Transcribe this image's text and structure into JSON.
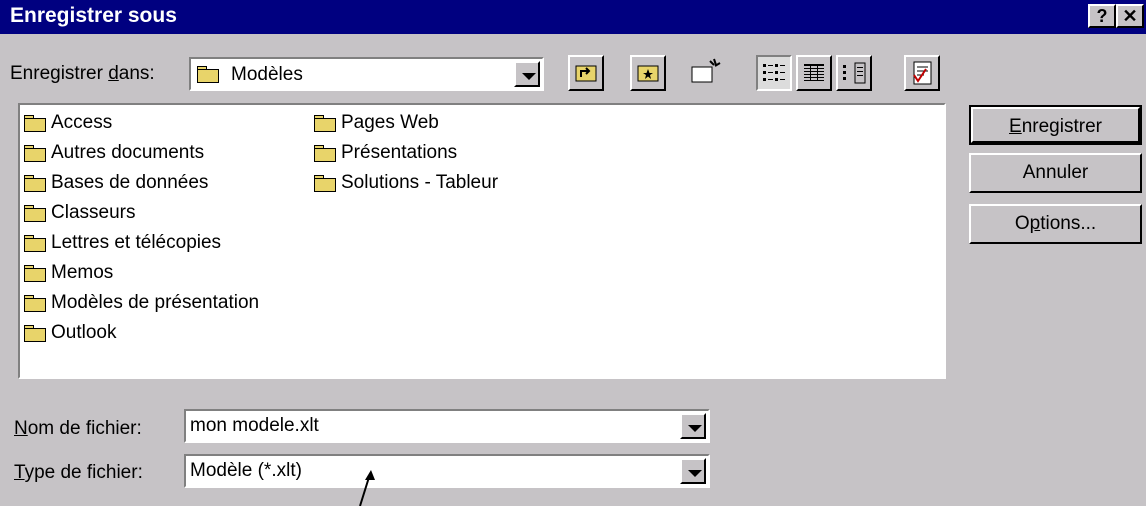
{
  "window": {
    "title": "Enregistrer sous",
    "help_icon": "?",
    "close_icon": "✕"
  },
  "save_in": {
    "label_prefix": "Enregistrer ",
    "label_underlined": "d",
    "label_suffix": "ans:",
    "value": "Modèles"
  },
  "toolbar": {
    "icons": [
      "up-one-level-icon",
      "favorites-icon",
      "new-folder-icon",
      "list-view-icon",
      "details-view-icon",
      "properties-view-icon",
      "tools-icon"
    ]
  },
  "files": {
    "column1": [
      "Access",
      "Autres documents",
      "Bases de données",
      "Classeurs",
      "Lettres et télécopies",
      "Memos",
      "Modèles de présentation",
      "Outlook"
    ],
    "column2": [
      "Pages Web",
      "Présentations",
      "Solutions - Tableur"
    ]
  },
  "buttons": {
    "save_underlined": "E",
    "save_rest": "nregistrer",
    "cancel": "Annuler",
    "options_prefix": "O",
    "options_underlined": "p",
    "options_suffix": "tions..."
  },
  "filename": {
    "label_underlined": "N",
    "label_rest": "om de fichier:",
    "value": "mon modele.xlt"
  },
  "filetype": {
    "label_underlined": "T",
    "label_rest": "ype de fichier:",
    "value": "Modèle (*.xlt)"
  }
}
